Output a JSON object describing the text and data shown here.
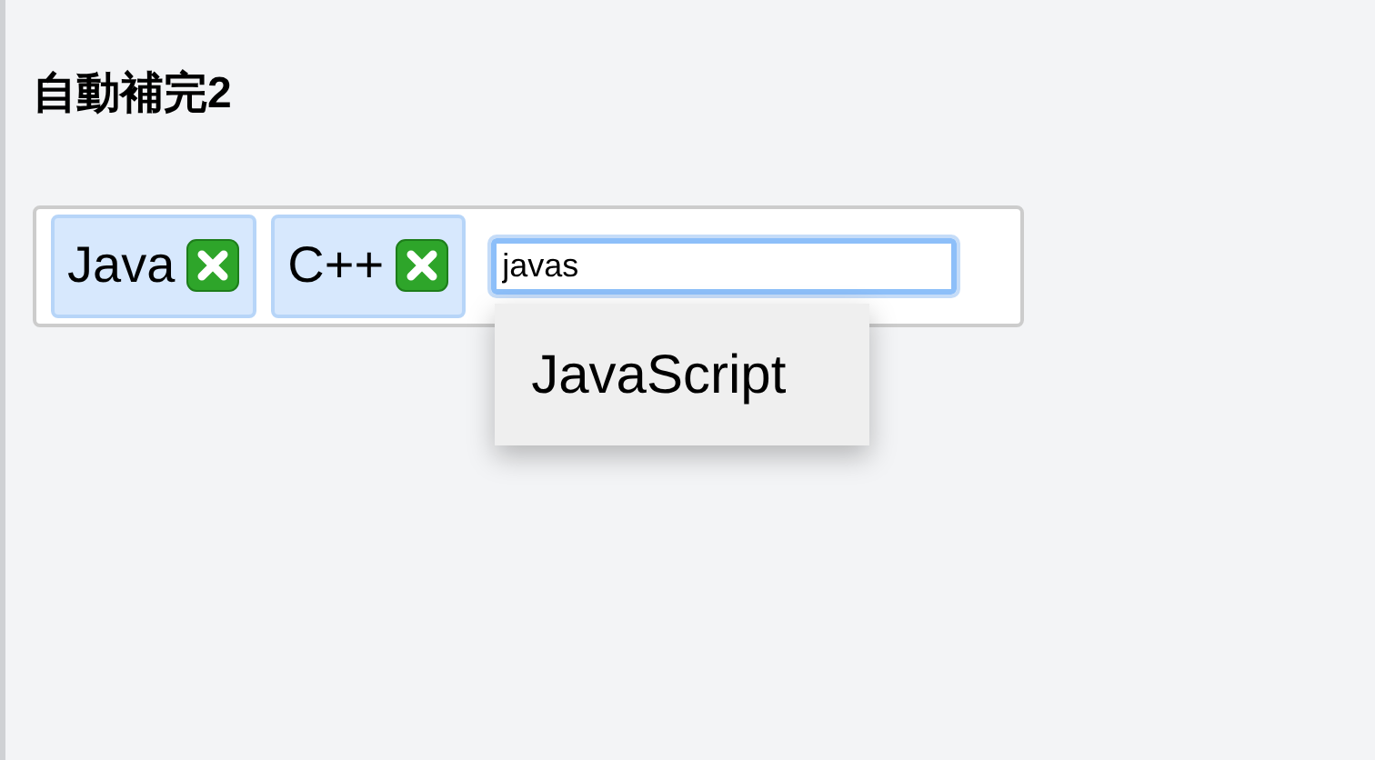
{
  "title": "自動補完2",
  "tags": [
    {
      "label": "Java"
    },
    {
      "label": "C++"
    }
  ],
  "input": {
    "value": "javas"
  },
  "suggestions": [
    {
      "label": "JavaScript"
    }
  ]
}
